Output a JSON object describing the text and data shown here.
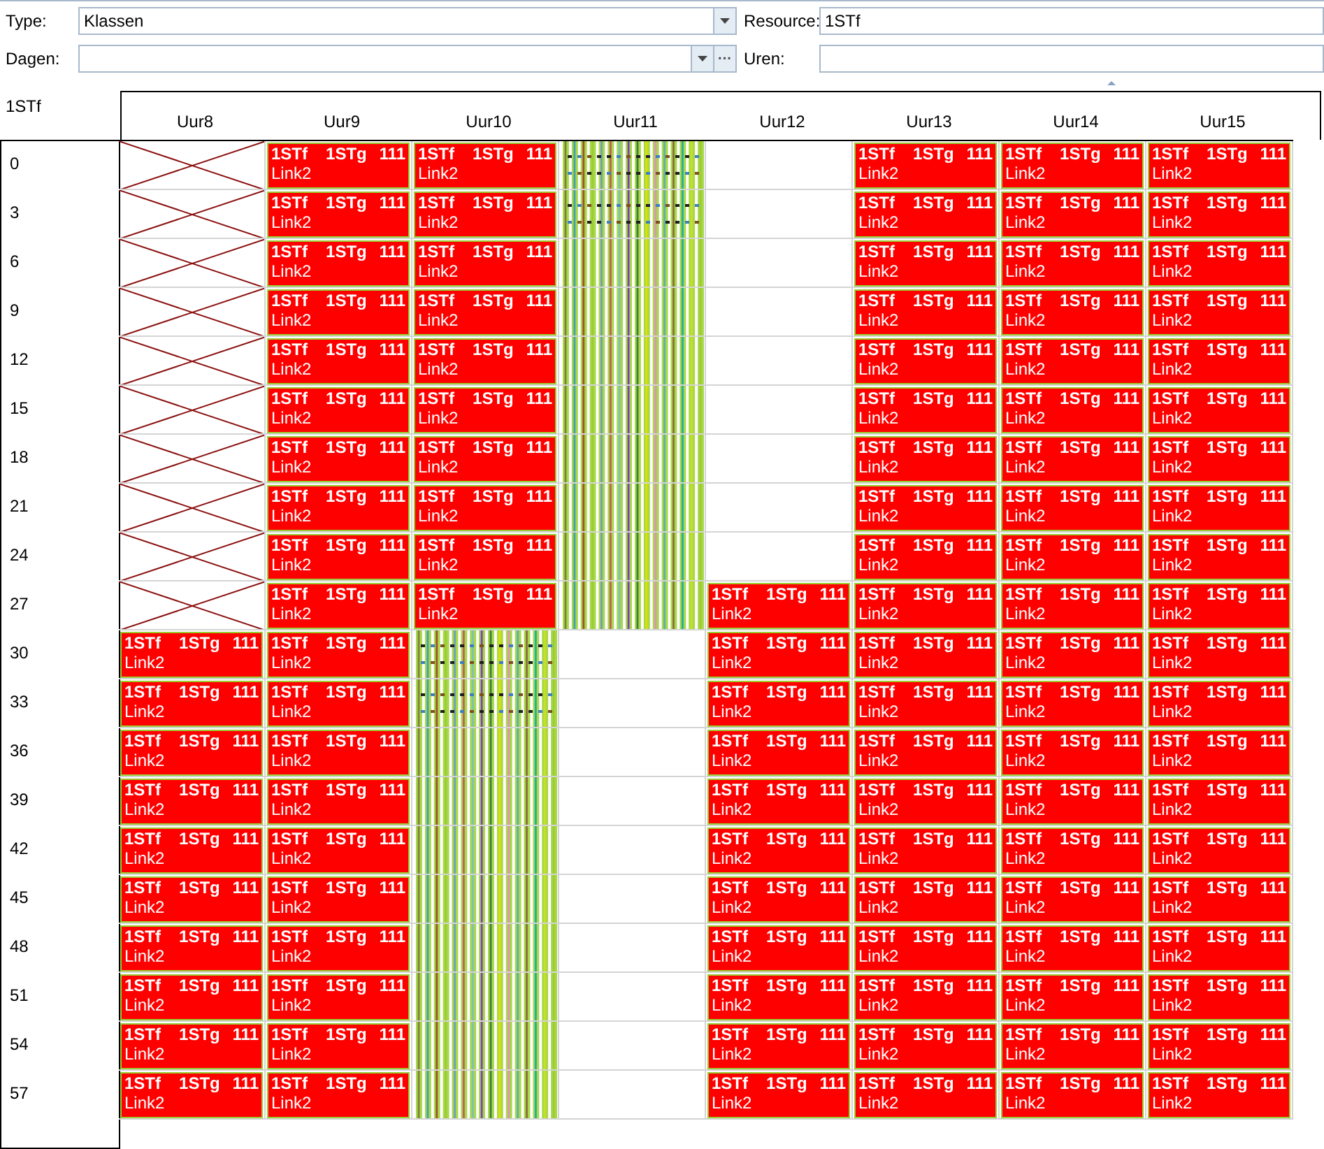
{
  "filters": {
    "type": {
      "label": "Type:",
      "value": "Klassen"
    },
    "resource": {
      "label": "Resource:",
      "value": "1STf"
    },
    "dagen": {
      "label": "Dagen:",
      "more": "···"
    },
    "uren": {
      "label": "Uren:"
    }
  },
  "resource_title": "1STf",
  "columns": [
    "Uur8",
    "Uur9",
    "Uur10",
    "Uur11",
    "Uur12",
    "Uur13",
    "Uur14",
    "Uur15"
  ],
  "rows": [
    {
      "label": "0",
      "cells": [
        {
          "kind": "blocked"
        },
        {
          "kind": "lesson",
          "class": "1STf",
          "group": "1STg",
          "room": "111",
          "link": "Link2"
        },
        {
          "kind": "lesson",
          "class": "1STf",
          "group": "1STg",
          "room": "111",
          "link": "Link2"
        },
        {
          "kind": "striped",
          "marked": true
        },
        {
          "kind": "empty"
        },
        {
          "kind": "lesson",
          "class": "1STf",
          "group": "1STg",
          "room": "111",
          "link": "Link2"
        },
        {
          "kind": "lesson",
          "class": "1STf",
          "group": "1STg",
          "room": "111",
          "link": "Link2"
        },
        {
          "kind": "lesson",
          "class": "1STf",
          "group": "1STg",
          "room": "111",
          "link": "Link2"
        }
      ]
    },
    {
      "label": "3",
      "cells": [
        {
          "kind": "blocked"
        },
        {
          "kind": "lesson",
          "class": "1STf",
          "group": "1STg",
          "room": "111",
          "link": "Link2"
        },
        {
          "kind": "lesson",
          "class": "1STf",
          "group": "1STg",
          "room": "111",
          "link": "Link2"
        },
        {
          "kind": "striped",
          "marked": true
        },
        {
          "kind": "empty"
        },
        {
          "kind": "lesson",
          "class": "1STf",
          "group": "1STg",
          "room": "111",
          "link": "Link2"
        },
        {
          "kind": "lesson",
          "class": "1STf",
          "group": "1STg",
          "room": "111",
          "link": "Link2"
        },
        {
          "kind": "lesson",
          "class": "1STf",
          "group": "1STg",
          "room": "111",
          "link": "Link2"
        }
      ]
    },
    {
      "label": "6",
      "cells": [
        {
          "kind": "blocked"
        },
        {
          "kind": "lesson",
          "class": "1STf",
          "group": "1STg",
          "room": "111",
          "link": "Link2"
        },
        {
          "kind": "lesson",
          "class": "1STf",
          "group": "1STg",
          "room": "111",
          "link": "Link2"
        },
        {
          "kind": "striped",
          "marked": false
        },
        {
          "kind": "empty"
        },
        {
          "kind": "lesson",
          "class": "1STf",
          "group": "1STg",
          "room": "111",
          "link": "Link2"
        },
        {
          "kind": "lesson",
          "class": "1STf",
          "group": "1STg",
          "room": "111",
          "link": "Link2"
        },
        {
          "kind": "lesson",
          "class": "1STf",
          "group": "1STg",
          "room": "111",
          "link": "Link2"
        }
      ]
    },
    {
      "label": "9",
      "cells": [
        {
          "kind": "blocked"
        },
        {
          "kind": "lesson",
          "class": "1STf",
          "group": "1STg",
          "room": "111",
          "link": "Link2"
        },
        {
          "kind": "lesson",
          "class": "1STf",
          "group": "1STg",
          "room": "111",
          "link": "Link2"
        },
        {
          "kind": "striped",
          "marked": false
        },
        {
          "kind": "empty"
        },
        {
          "kind": "lesson",
          "class": "1STf",
          "group": "1STg",
          "room": "111",
          "link": "Link2"
        },
        {
          "kind": "lesson",
          "class": "1STf",
          "group": "1STg",
          "room": "111",
          "link": "Link2"
        },
        {
          "kind": "lesson",
          "class": "1STf",
          "group": "1STg",
          "room": "111",
          "link": "Link2"
        }
      ]
    },
    {
      "label": "12",
      "cells": [
        {
          "kind": "blocked"
        },
        {
          "kind": "lesson",
          "class": "1STf",
          "group": "1STg",
          "room": "111",
          "link": "Link2"
        },
        {
          "kind": "lesson",
          "class": "1STf",
          "group": "1STg",
          "room": "111",
          "link": "Link2"
        },
        {
          "kind": "striped",
          "marked": false
        },
        {
          "kind": "empty"
        },
        {
          "kind": "lesson",
          "class": "1STf",
          "group": "1STg",
          "room": "111",
          "link": "Link2"
        },
        {
          "kind": "lesson",
          "class": "1STf",
          "group": "1STg",
          "room": "111",
          "link": "Link2"
        },
        {
          "kind": "lesson",
          "class": "1STf",
          "group": "1STg",
          "room": "111",
          "link": "Link2"
        }
      ]
    },
    {
      "label": "15",
      "cells": [
        {
          "kind": "blocked"
        },
        {
          "kind": "lesson",
          "class": "1STf",
          "group": "1STg",
          "room": "111",
          "link": "Link2"
        },
        {
          "kind": "lesson",
          "class": "1STf",
          "group": "1STg",
          "room": "111",
          "link": "Link2"
        },
        {
          "kind": "striped",
          "marked": false
        },
        {
          "kind": "empty"
        },
        {
          "kind": "lesson",
          "class": "1STf",
          "group": "1STg",
          "room": "111",
          "link": "Link2"
        },
        {
          "kind": "lesson",
          "class": "1STf",
          "group": "1STg",
          "room": "111",
          "link": "Link2"
        },
        {
          "kind": "lesson",
          "class": "1STf",
          "group": "1STg",
          "room": "111",
          "link": "Link2"
        }
      ]
    },
    {
      "label": "18",
      "cells": [
        {
          "kind": "blocked"
        },
        {
          "kind": "lesson",
          "class": "1STf",
          "group": "1STg",
          "room": "111",
          "link": "Link2"
        },
        {
          "kind": "lesson",
          "class": "1STf",
          "group": "1STg",
          "room": "111",
          "link": "Link2"
        },
        {
          "kind": "striped",
          "marked": false
        },
        {
          "kind": "empty"
        },
        {
          "kind": "lesson",
          "class": "1STf",
          "group": "1STg",
          "room": "111",
          "link": "Link2"
        },
        {
          "kind": "lesson",
          "class": "1STf",
          "group": "1STg",
          "room": "111",
          "link": "Link2"
        },
        {
          "kind": "lesson",
          "class": "1STf",
          "group": "1STg",
          "room": "111",
          "link": "Link2"
        }
      ]
    },
    {
      "label": "21",
      "cells": [
        {
          "kind": "blocked"
        },
        {
          "kind": "lesson",
          "class": "1STf",
          "group": "1STg",
          "room": "111",
          "link": "Link2"
        },
        {
          "kind": "lesson",
          "class": "1STf",
          "group": "1STg",
          "room": "111",
          "link": "Link2"
        },
        {
          "kind": "striped",
          "marked": false
        },
        {
          "kind": "empty"
        },
        {
          "kind": "lesson",
          "class": "1STf",
          "group": "1STg",
          "room": "111",
          "link": "Link2"
        },
        {
          "kind": "lesson",
          "class": "1STf",
          "group": "1STg",
          "room": "111",
          "link": "Link2"
        },
        {
          "kind": "lesson",
          "class": "1STf",
          "group": "1STg",
          "room": "111",
          "link": "Link2"
        }
      ]
    },
    {
      "label": "24",
      "cells": [
        {
          "kind": "blocked"
        },
        {
          "kind": "lesson",
          "class": "1STf",
          "group": "1STg",
          "room": "111",
          "link": "Link2"
        },
        {
          "kind": "lesson",
          "class": "1STf",
          "group": "1STg",
          "room": "111",
          "link": "Link2"
        },
        {
          "kind": "striped",
          "marked": false
        },
        {
          "kind": "empty"
        },
        {
          "kind": "lesson",
          "class": "1STf",
          "group": "1STg",
          "room": "111",
          "link": "Link2"
        },
        {
          "kind": "lesson",
          "class": "1STf",
          "group": "1STg",
          "room": "111",
          "link": "Link2"
        },
        {
          "kind": "lesson",
          "class": "1STf",
          "group": "1STg",
          "room": "111",
          "link": "Link2"
        }
      ]
    },
    {
      "label": "27",
      "cells": [
        {
          "kind": "blocked"
        },
        {
          "kind": "lesson",
          "class": "1STf",
          "group": "1STg",
          "room": "111",
          "link": "Link2"
        },
        {
          "kind": "lesson",
          "class": "1STf",
          "group": "1STg",
          "room": "111",
          "link": "Link2"
        },
        {
          "kind": "striped",
          "marked": false
        },
        {
          "kind": "lesson",
          "class": "1STf",
          "group": "1STg",
          "room": "111",
          "link": "Link2"
        },
        {
          "kind": "lesson",
          "class": "1STf",
          "group": "1STg",
          "room": "111",
          "link": "Link2"
        },
        {
          "kind": "lesson",
          "class": "1STf",
          "group": "1STg",
          "room": "111",
          "link": "Link2"
        },
        {
          "kind": "lesson",
          "class": "1STf",
          "group": "1STg",
          "room": "111",
          "link": "Link2"
        }
      ]
    },
    {
      "label": "30",
      "cells": [
        {
          "kind": "lesson",
          "class": "1STf",
          "group": "1STg",
          "room": "111",
          "link": "Link2"
        },
        {
          "kind": "lesson",
          "class": "1STf",
          "group": "1STg",
          "room": "111",
          "link": "Link2"
        },
        {
          "kind": "striped",
          "marked": true
        },
        {
          "kind": "empty"
        },
        {
          "kind": "lesson",
          "class": "1STf",
          "group": "1STg",
          "room": "111",
          "link": "Link2"
        },
        {
          "kind": "lesson",
          "class": "1STf",
          "group": "1STg",
          "room": "111",
          "link": "Link2"
        },
        {
          "kind": "lesson",
          "class": "1STf",
          "group": "1STg",
          "room": "111",
          "link": "Link2"
        },
        {
          "kind": "lesson",
          "class": "1STf",
          "group": "1STg",
          "room": "111",
          "link": "Link2"
        }
      ]
    },
    {
      "label": "33",
      "cells": [
        {
          "kind": "lesson",
          "class": "1STf",
          "group": "1STg",
          "room": "111",
          "link": "Link2"
        },
        {
          "kind": "lesson",
          "class": "1STf",
          "group": "1STg",
          "room": "111",
          "link": "Link2"
        },
        {
          "kind": "striped",
          "marked": true
        },
        {
          "kind": "empty"
        },
        {
          "kind": "lesson",
          "class": "1STf",
          "group": "1STg",
          "room": "111",
          "link": "Link2"
        },
        {
          "kind": "lesson",
          "class": "1STf",
          "group": "1STg",
          "room": "111",
          "link": "Link2"
        },
        {
          "kind": "lesson",
          "class": "1STf",
          "group": "1STg",
          "room": "111",
          "link": "Link2"
        },
        {
          "kind": "lesson",
          "class": "1STf",
          "group": "1STg",
          "room": "111",
          "link": "Link2"
        }
      ]
    },
    {
      "label": "36",
      "cells": [
        {
          "kind": "lesson",
          "class": "1STf",
          "group": "1STg",
          "room": "111",
          "link": "Link2"
        },
        {
          "kind": "lesson",
          "class": "1STf",
          "group": "1STg",
          "room": "111",
          "link": "Link2"
        },
        {
          "kind": "striped",
          "marked": false
        },
        {
          "kind": "empty"
        },
        {
          "kind": "lesson",
          "class": "1STf",
          "group": "1STg",
          "room": "111",
          "link": "Link2"
        },
        {
          "kind": "lesson",
          "class": "1STf",
          "group": "1STg",
          "room": "111",
          "link": "Link2"
        },
        {
          "kind": "lesson",
          "class": "1STf",
          "group": "1STg",
          "room": "111",
          "link": "Link2"
        },
        {
          "kind": "lesson",
          "class": "1STf",
          "group": "1STg",
          "room": "111",
          "link": "Link2"
        }
      ]
    },
    {
      "label": "39",
      "cells": [
        {
          "kind": "lesson",
          "class": "1STf",
          "group": "1STg",
          "room": "111",
          "link": "Link2"
        },
        {
          "kind": "lesson",
          "class": "1STf",
          "group": "1STg",
          "room": "111",
          "link": "Link2"
        },
        {
          "kind": "striped",
          "marked": false
        },
        {
          "kind": "empty"
        },
        {
          "kind": "lesson",
          "class": "1STf",
          "group": "1STg",
          "room": "111",
          "link": "Link2"
        },
        {
          "kind": "lesson",
          "class": "1STf",
          "group": "1STg",
          "room": "111",
          "link": "Link2"
        },
        {
          "kind": "lesson",
          "class": "1STf",
          "group": "1STg",
          "room": "111",
          "link": "Link2"
        },
        {
          "kind": "lesson",
          "class": "1STf",
          "group": "1STg",
          "room": "111",
          "link": "Link2"
        }
      ]
    },
    {
      "label": "42",
      "cells": [
        {
          "kind": "lesson",
          "class": "1STf",
          "group": "1STg",
          "room": "111",
          "link": "Link2"
        },
        {
          "kind": "lesson",
          "class": "1STf",
          "group": "1STg",
          "room": "111",
          "link": "Link2"
        },
        {
          "kind": "striped",
          "marked": false
        },
        {
          "kind": "empty"
        },
        {
          "kind": "lesson",
          "class": "1STf",
          "group": "1STg",
          "room": "111",
          "link": "Link2"
        },
        {
          "kind": "lesson",
          "class": "1STf",
          "group": "1STg",
          "room": "111",
          "link": "Link2"
        },
        {
          "kind": "lesson",
          "class": "1STf",
          "group": "1STg",
          "room": "111",
          "link": "Link2"
        },
        {
          "kind": "lesson",
          "class": "1STf",
          "group": "1STg",
          "room": "111",
          "link": "Link2"
        }
      ]
    },
    {
      "label": "45",
      "cells": [
        {
          "kind": "lesson",
          "class": "1STf",
          "group": "1STg",
          "room": "111",
          "link": "Link2"
        },
        {
          "kind": "lesson",
          "class": "1STf",
          "group": "1STg",
          "room": "111",
          "link": "Link2"
        },
        {
          "kind": "striped",
          "marked": false
        },
        {
          "kind": "empty"
        },
        {
          "kind": "lesson",
          "class": "1STf",
          "group": "1STg",
          "room": "111",
          "link": "Link2"
        },
        {
          "kind": "lesson",
          "class": "1STf",
          "group": "1STg",
          "room": "111",
          "link": "Link2"
        },
        {
          "kind": "lesson",
          "class": "1STf",
          "group": "1STg",
          "room": "111",
          "link": "Link2"
        },
        {
          "kind": "lesson",
          "class": "1STf",
          "group": "1STg",
          "room": "111",
          "link": "Link2"
        }
      ]
    },
    {
      "label": "48",
      "cells": [
        {
          "kind": "lesson",
          "class": "1STf",
          "group": "1STg",
          "room": "111",
          "link": "Link2"
        },
        {
          "kind": "lesson",
          "class": "1STf",
          "group": "1STg",
          "room": "111",
          "link": "Link2"
        },
        {
          "kind": "striped",
          "marked": false
        },
        {
          "kind": "empty"
        },
        {
          "kind": "lesson",
          "class": "1STf",
          "group": "1STg",
          "room": "111",
          "link": "Link2"
        },
        {
          "kind": "lesson",
          "class": "1STf",
          "group": "1STg",
          "room": "111",
          "link": "Link2"
        },
        {
          "kind": "lesson",
          "class": "1STf",
          "group": "1STg",
          "room": "111",
          "link": "Link2"
        },
        {
          "kind": "lesson",
          "class": "1STf",
          "group": "1STg",
          "room": "111",
          "link": "Link2"
        }
      ]
    },
    {
      "label": "51",
      "cells": [
        {
          "kind": "lesson",
          "class": "1STf",
          "group": "1STg",
          "room": "111",
          "link": "Link2"
        },
        {
          "kind": "lesson",
          "class": "1STf",
          "group": "1STg",
          "room": "111",
          "link": "Link2"
        },
        {
          "kind": "striped",
          "marked": false
        },
        {
          "kind": "empty"
        },
        {
          "kind": "lesson",
          "class": "1STf",
          "group": "1STg",
          "room": "111",
          "link": "Link2"
        },
        {
          "kind": "lesson",
          "class": "1STf",
          "group": "1STg",
          "room": "111",
          "link": "Link2"
        },
        {
          "kind": "lesson",
          "class": "1STf",
          "group": "1STg",
          "room": "111",
          "link": "Link2"
        },
        {
          "kind": "lesson",
          "class": "1STf",
          "group": "1STg",
          "room": "111",
          "link": "Link2"
        }
      ]
    },
    {
      "label": "54",
      "cells": [
        {
          "kind": "lesson",
          "class": "1STf",
          "group": "1STg",
          "room": "111",
          "link": "Link2"
        },
        {
          "kind": "lesson",
          "class": "1STf",
          "group": "1STg",
          "room": "111",
          "link": "Link2"
        },
        {
          "kind": "striped",
          "marked": false
        },
        {
          "kind": "empty"
        },
        {
          "kind": "lesson",
          "class": "1STf",
          "group": "1STg",
          "room": "111",
          "link": "Link2"
        },
        {
          "kind": "lesson",
          "class": "1STf",
          "group": "1STg",
          "room": "111",
          "link": "Link2"
        },
        {
          "kind": "lesson",
          "class": "1STf",
          "group": "1STg",
          "room": "111",
          "link": "Link2"
        },
        {
          "kind": "lesson",
          "class": "1STf",
          "group": "1STg",
          "room": "111",
          "link": "Link2"
        }
      ]
    },
    {
      "label": "57",
      "cells": [
        {
          "kind": "lesson",
          "class": "1STf",
          "group": "1STg",
          "room": "111",
          "link": "Link2"
        },
        {
          "kind": "lesson",
          "class": "1STf",
          "group": "1STg",
          "room": "111",
          "link": "Link2"
        },
        {
          "kind": "striped",
          "marked": false
        },
        {
          "kind": "empty"
        },
        {
          "kind": "lesson",
          "class": "1STf",
          "group": "1STg",
          "room": "111",
          "link": "Link2"
        },
        {
          "kind": "lesson",
          "class": "1STf",
          "group": "1STg",
          "room": "111",
          "link": "Link2"
        },
        {
          "kind": "lesson",
          "class": "1STf",
          "group": "1STg",
          "room": "111",
          "link": "Link2"
        },
        {
          "kind": "lesson",
          "class": "1STf",
          "group": "1STg",
          "room": "111",
          "link": "Link2"
        }
      ]
    }
  ]
}
